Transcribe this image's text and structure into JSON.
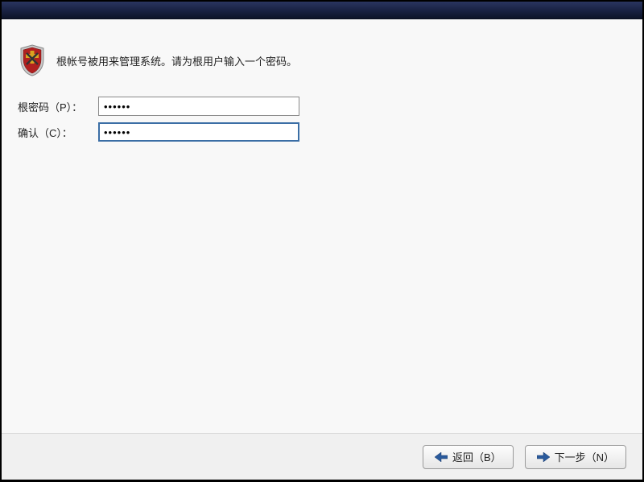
{
  "header": {
    "instruction": "根帐号被用来管理系统。请为根用户输入一个密码。",
    "icon": "shield-icon"
  },
  "form": {
    "password_label": "根密码（P）：",
    "password_value": "••••••",
    "confirm_label": "确认（C）：",
    "confirm_value": "••••••"
  },
  "footer": {
    "back_label": "返回（B）",
    "next_label": "下一步（N）"
  },
  "colors": {
    "titlebar": "#1a2344",
    "accent": "#3b6ea5",
    "shield_red": "#b02020",
    "shield_yellow": "#d9a520"
  }
}
